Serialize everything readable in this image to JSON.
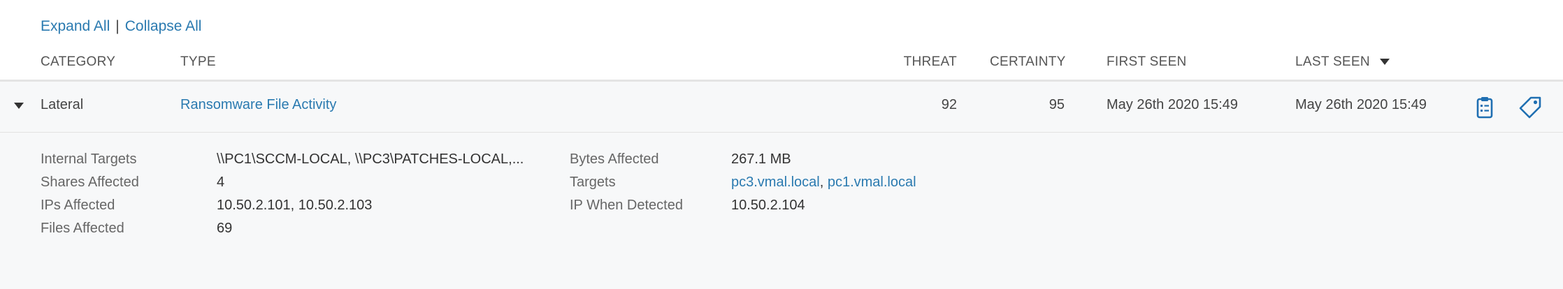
{
  "toolbar": {
    "expand_all": "Expand All",
    "separator": "|",
    "collapse_all": "Collapse All"
  },
  "columns": {
    "category": "CATEGORY",
    "type": "TYPE",
    "threat": "THREAT",
    "certainty": "CERTAINTY",
    "first_seen": "FIRST SEEN",
    "last_seen": "LAST SEEN"
  },
  "sort": {
    "column": "last_seen",
    "direction": "descending"
  },
  "row": {
    "category": "Lateral",
    "type": "Ransomware File Activity",
    "threat": "92",
    "certainty": "95",
    "first_seen": "May 26th 2020 15:49",
    "last_seen": "May 26th 2020 15:49",
    "actions": [
      "clipboard-icon",
      "tag-icon"
    ]
  },
  "details": {
    "internal_targets": {
      "label": "Internal Targets",
      "value": "\\\\PC1\\SCCM-LOCAL, \\\\PC3\\PATCHES-LOCAL,..."
    },
    "shares_affected": {
      "label": "Shares Affected",
      "value": "4"
    },
    "ips_affected": {
      "label": "IPs Affected",
      "value": "10.50.2.101, 10.50.2.103"
    },
    "files_affected": {
      "label": "Files Affected",
      "value": "69"
    },
    "bytes_affected": {
      "label": "Bytes Affected",
      "value": "267.1 MB"
    },
    "targets": {
      "label": "Targets",
      "values": [
        "pc3.vmal.local",
        "pc1.vmal.local"
      ],
      "separator": ","
    },
    "ip_when_detected": {
      "label": "IP When Detected",
      "value": "10.50.2.104"
    }
  },
  "colors": {
    "link": "#2a7ab0",
    "row_background": "#f7f8f9"
  }
}
